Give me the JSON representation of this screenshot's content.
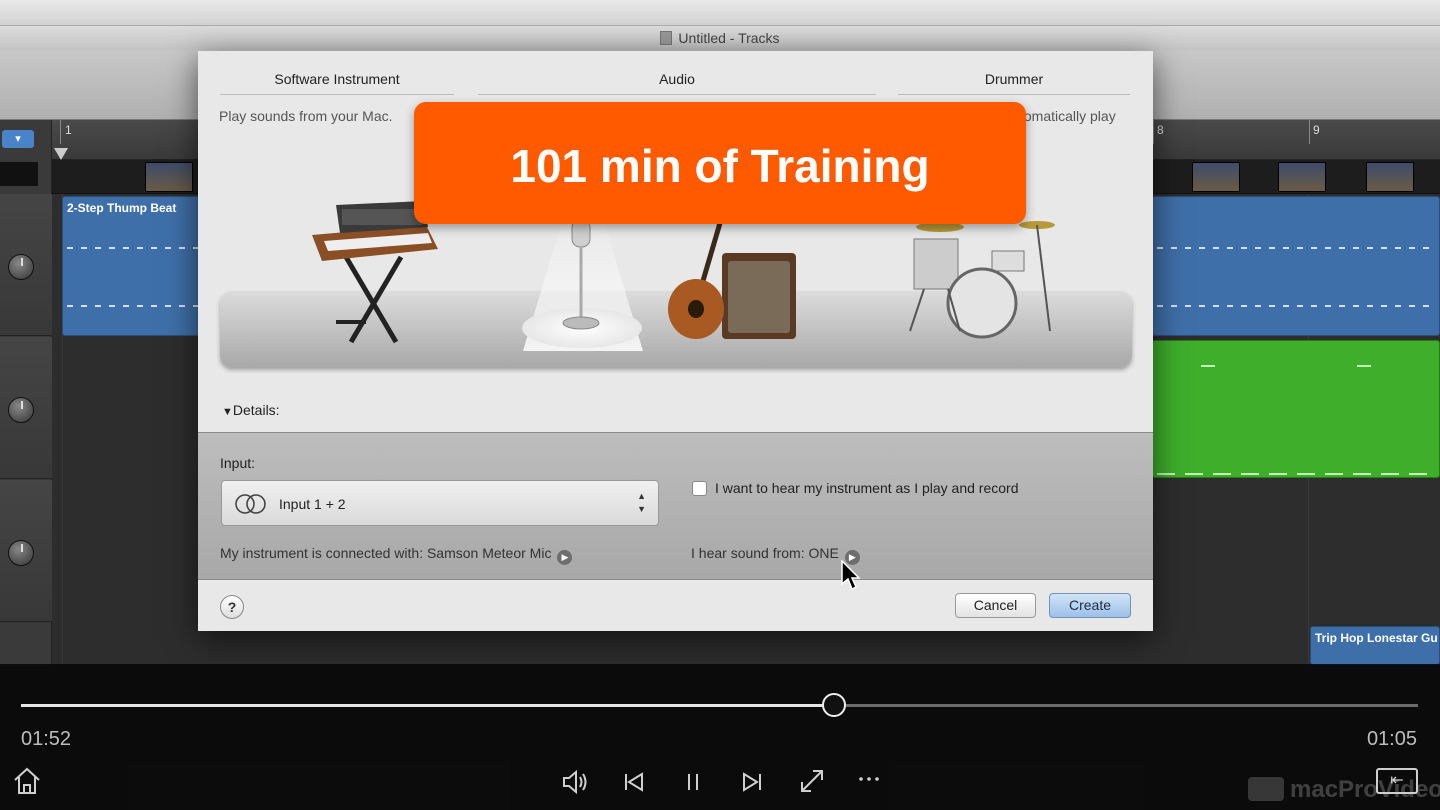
{
  "window": {
    "title": "Untitled - Tracks"
  },
  "ruler": {
    "markers": [
      "1",
      "8",
      "9"
    ]
  },
  "tracks": {
    "regions": [
      {
        "label": "2-Step Thump Beat"
      },
      {
        "label": "Trip Hop Lonestar Gu"
      }
    ]
  },
  "dialog": {
    "tabs": [
      {
        "label": "Software Instrument",
        "desc": "Play sounds from your Mac."
      },
      {
        "label": "Audio",
        "desc": ""
      },
      {
        "label": "Drummer",
        "desc": "tomatically play"
      }
    ],
    "details_label": "Details:",
    "input_label": "Input:",
    "input_value": "Input 1 + 2",
    "monitor_label": "I want to hear my instrument as I play and record",
    "monitor_checked": false,
    "connected_label": "My instrument is connected with: Samson Meteor Mic",
    "hear_label": "I hear sound from: ONE",
    "help_label": "?",
    "cancel_label": "Cancel",
    "create_label": "Create"
  },
  "promo": {
    "text": "101 min of Training"
  },
  "player": {
    "elapsed": "01:52",
    "remaining": "01:05",
    "progress": 0.582,
    "watermark": "macProVideo"
  },
  "colors": {
    "promo_orange": "#ff5a00",
    "region_blue": "#3f6fa8",
    "region_green": "#3fae2b",
    "create_button": "#9cc0e8"
  },
  "icons": [
    "home-icon",
    "volume-icon",
    "previous-icon",
    "pause-icon",
    "next-icon",
    "fullscreen-icon",
    "more-icon",
    "exit-fullscreen-icon",
    "help-icon",
    "info-arrow-icon"
  ]
}
